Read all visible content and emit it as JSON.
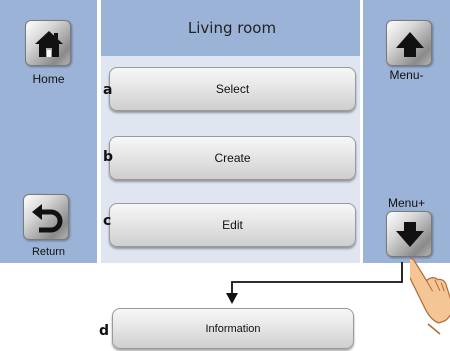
{
  "title": "Living room",
  "left": {
    "home_label": "Home",
    "return_label": "Return"
  },
  "right": {
    "menu_minus_label": "Menu-",
    "menu_plus_label": "Menu+"
  },
  "menu": {
    "select_label": "Select",
    "create_label": "Create",
    "edit_label": "Edit"
  },
  "markers": {
    "a": "a",
    "b": "b",
    "c": "c",
    "d": "d"
  },
  "extra": {
    "information_label": "Information"
  },
  "icons": {
    "home": "home-icon",
    "return": "return-arrow-icon",
    "menu_minus": "arrow-up-icon",
    "menu_plus": "arrow-down-icon",
    "pointer": "pointing-hand-icon"
  },
  "colors": {
    "side_panel": "#9cb3d8",
    "center_panel": "#dfe6f1"
  }
}
